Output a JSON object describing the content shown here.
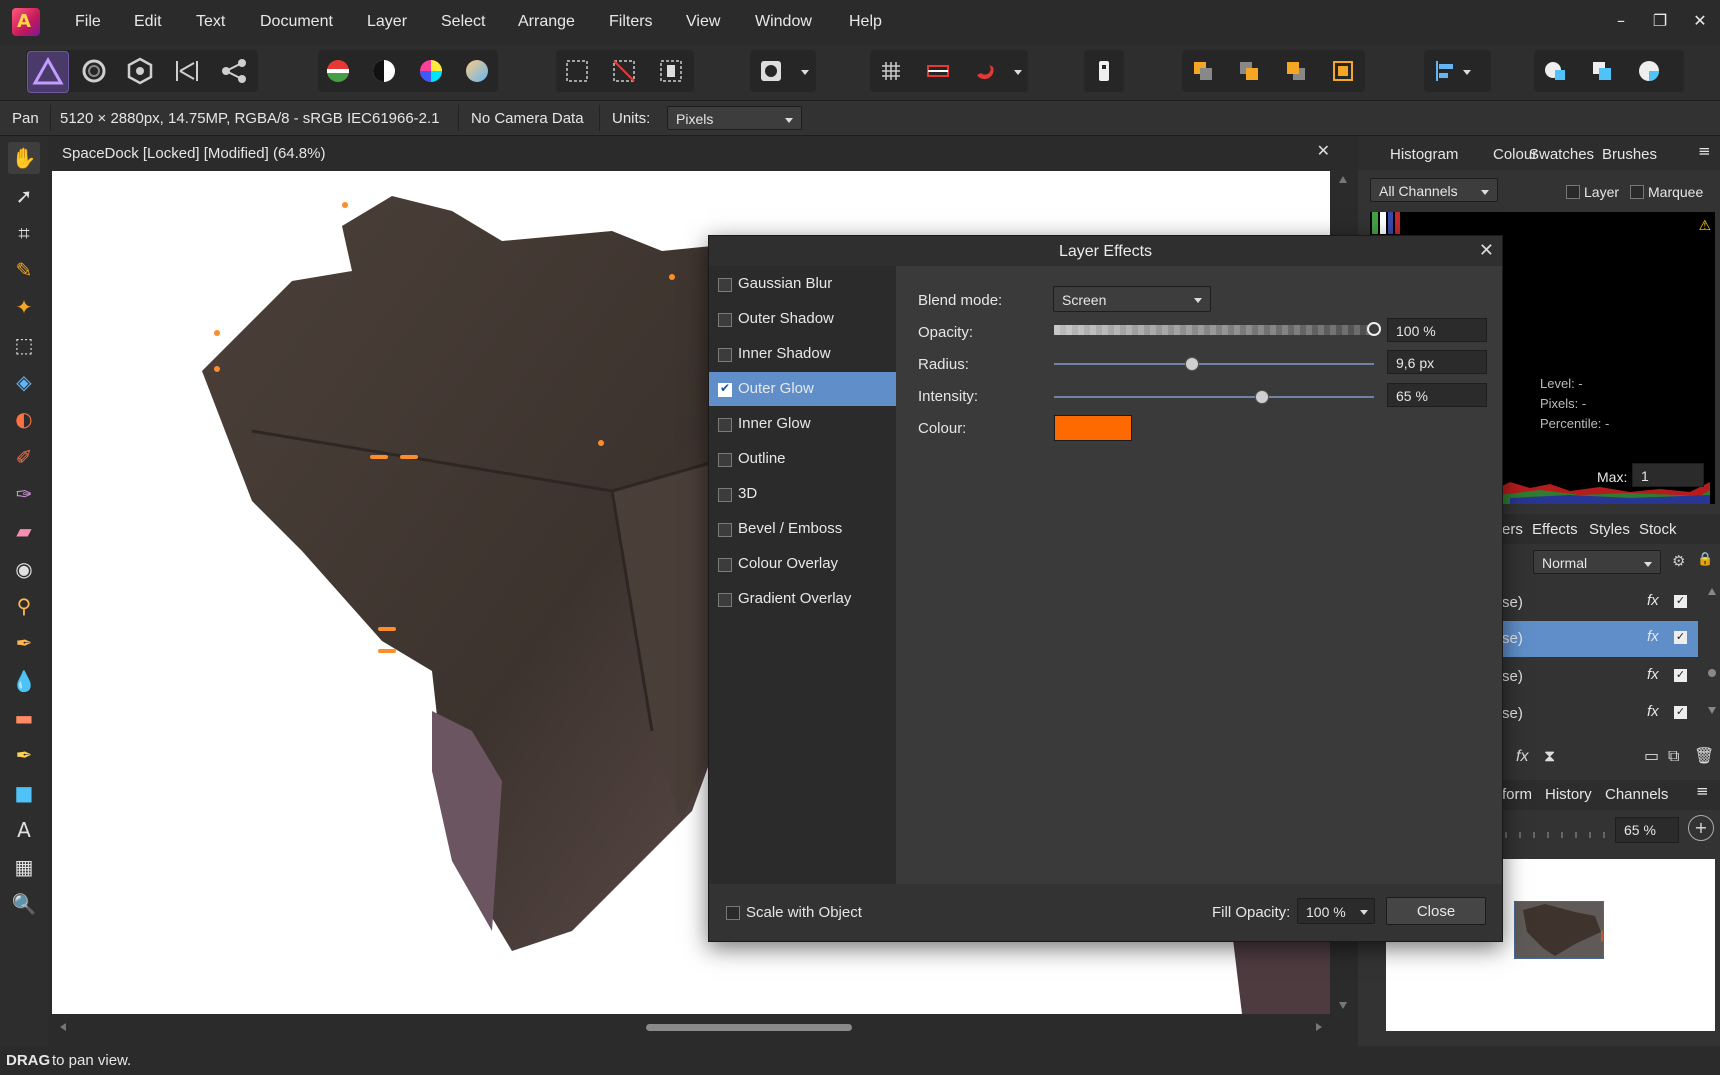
{
  "menu": [
    "File",
    "Edit",
    "Text",
    "Document",
    "Layer",
    "Select",
    "Arrange",
    "Filters",
    "View",
    "Window",
    "Help"
  ],
  "window_controls": {
    "minimize": "–",
    "restore": "❐",
    "close": "✕"
  },
  "context_bar": {
    "tool": "Pan",
    "doc_info": "5120 × 2880px, 14.75MP, RGBA/8 - sRGB IEC61966-2.1",
    "camera": "No Camera Data",
    "units_label": "Units:",
    "units_value": "Pixels"
  },
  "document": {
    "title": "SpaceDock [Locked] [Modified] (64.8%)",
    "close_glyph": "✕"
  },
  "status": {
    "bold": "DRAG",
    "text": " to pan view."
  },
  "histogram_panel": {
    "tabs": [
      "Histogram",
      "Colour",
      "Swatches",
      "Brushes"
    ],
    "channel_select": "All Channels",
    "layer_check": "Layer",
    "marquee_check": "Marquee",
    "warning": "⚠",
    "level": "Level: -",
    "pixels": "Pixels: -",
    "percentile": "Percentile: -",
    "max_label": "Max:",
    "max_value": "1"
  },
  "layers_panel": {
    "tabs": [
      "ers",
      "Effects",
      "Styles",
      "Stock"
    ],
    "blend": "Normal",
    "rows": [
      "se)",
      "se)",
      "se)",
      "se)"
    ],
    "fx": "fx"
  },
  "nav_panel": {
    "tabs": [
      "form",
      "History",
      "Channels"
    ],
    "zoom": "65 %"
  },
  "dialog": {
    "title": "Layer Effects",
    "close_glyph": "✕",
    "effects": [
      {
        "label": "Gaussian Blur",
        "checked": false
      },
      {
        "label": "Outer Shadow",
        "checked": false
      },
      {
        "label": "Inner Shadow",
        "checked": false
      },
      {
        "label": "Outer Glow",
        "checked": true
      },
      {
        "label": "Inner Glow",
        "checked": false
      },
      {
        "label": "Outline",
        "checked": false
      },
      {
        "label": "3D",
        "checked": false
      },
      {
        "label": "Bevel / Emboss",
        "checked": false
      },
      {
        "label": "Colour Overlay",
        "checked": false
      },
      {
        "label": "Gradient Overlay",
        "checked": false
      }
    ],
    "blend_mode_label": "Blend mode:",
    "blend_mode_value": "Screen",
    "opacity_label": "Opacity:",
    "opacity_value": "100 %",
    "opacity_fraction": 1.0,
    "radius_label": "Radius:",
    "radius_value": "9,6 px",
    "radius_fraction": 0.43,
    "intensity_label": "Intensity:",
    "intensity_value": "65 %",
    "intensity_fraction": 0.65,
    "colour_label": "Colour:",
    "colour_value": "#ff6a00",
    "scale_label": "Scale with Object",
    "fill_opacity_label": "Fill Opacity:",
    "fill_opacity_value": "100 %",
    "close_button": "Close"
  },
  "colors": {
    "accent": "#5f8ec9",
    "glow": "#ff6a00"
  }
}
